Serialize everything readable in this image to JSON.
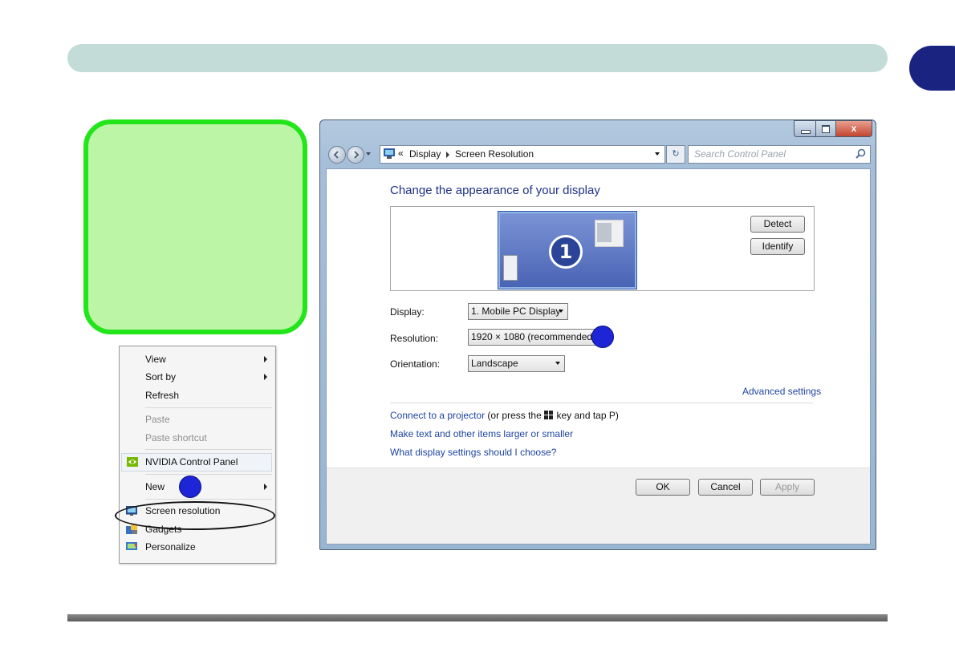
{
  "context_menu": {
    "items": [
      {
        "label": "View",
        "submenu": true,
        "enabled": true
      },
      {
        "label": "Sort by",
        "submenu": true,
        "enabled": true
      },
      {
        "label": "Refresh",
        "submenu": false,
        "enabled": true
      },
      {
        "label": "Paste",
        "submenu": false,
        "enabled": false
      },
      {
        "label": "Paste shortcut",
        "submenu": false,
        "enabled": false
      },
      {
        "label": "NVIDIA Control Panel",
        "icon": "nvidia-icon",
        "enabled": true
      },
      {
        "label": "New",
        "submenu": true,
        "enabled": true
      },
      {
        "label": "Screen resolution",
        "icon": "monitor-icon",
        "enabled": true,
        "circled": true
      },
      {
        "label": "Gadgets",
        "icon": "gadgets-icon",
        "enabled": true
      },
      {
        "label": "Personalize",
        "icon": "personalize-icon",
        "enabled": true
      }
    ]
  },
  "window": {
    "breadcrumb": {
      "back": "«",
      "part1": "Display",
      "part2": "Screen Resolution"
    },
    "search_placeholder": "Search Control Panel",
    "page_title": "Change the appearance of your display",
    "monitor_number": "1",
    "detect_label": "Detect",
    "identify_label": "Identify",
    "fields": {
      "display_label": "Display:",
      "display_value": "1. Mobile PC Display",
      "resolution_label": "Resolution:",
      "resolution_value": "1920 × 1080 (recommended)",
      "orientation_label": "Orientation:",
      "orientation_value": "Landscape"
    },
    "advanced_link": "Advanced settings",
    "projector_link": "Connect to a projector",
    "projector_text_before": "(or press the",
    "projector_text_after": "key and tap P)",
    "text_size_link": "Make text and other items larger or smaller",
    "help_link": "What display settings should I choose?",
    "ok_label": "OK",
    "cancel_label": "Cancel",
    "apply_label": "Apply"
  },
  "colors": {
    "header_bar": "#c3dcd7",
    "chapter_tab": "#1a2380",
    "green_panel_fill": "#bdf5a6",
    "green_panel_border": "#22e51a",
    "callout_dot": "#1e25d6",
    "link": "#1e44a3",
    "title": "#1e3287"
  }
}
